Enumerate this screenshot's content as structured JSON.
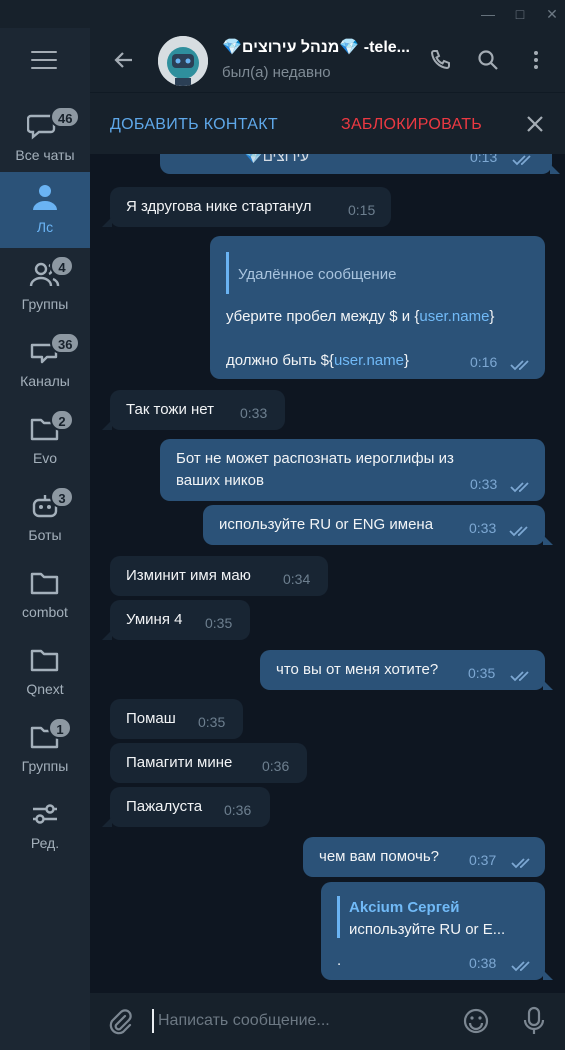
{
  "window": {
    "minimize": "—",
    "maximize": "□",
    "close": "✕"
  },
  "rail": {
    "folders": [
      {
        "label": "Все чаты",
        "badge": "46",
        "icon": "chats-icon"
      },
      {
        "label": "Лс",
        "badge": "",
        "icon": "person-icon"
      },
      {
        "label": "Группы",
        "badge": "4",
        "icon": "group-icon"
      },
      {
        "label": "Каналы",
        "badge": "36",
        "icon": "channel-icon"
      },
      {
        "label": "Evo",
        "badge": "2",
        "icon": "folder-icon"
      },
      {
        "label": "Боты",
        "badge": "3",
        "icon": "bot-icon"
      },
      {
        "label": "combot",
        "badge": "",
        "icon": "folder-icon"
      },
      {
        "label": "Qnext",
        "badge": "",
        "icon": "folder-icon"
      },
      {
        "label": "Группы",
        "badge": "1",
        "icon": "folder-icon"
      },
      {
        "label": "Ред.",
        "badge": "",
        "icon": "edit-sliders-icon"
      }
    ]
  },
  "header": {
    "title": "💎מנהל עירוצים💎 -tele...",
    "status": "был(а) недавно"
  },
  "actions": {
    "add_contact": "ДОБАВИТЬ КОНТАКТ",
    "block": "ЗАБЛОКИРОВАТЬ"
  },
  "messages": [
    {
      "text": "💎עירוצים",
      "time": "0:13"
    },
    {
      "text": "Я здругова нике стартанул",
      "time": "0:15"
    },
    {
      "quote": "Удалённое сообщение",
      "line1a": "уберите пробел между $ и {",
      "line1link": "user.name",
      "line1b": "}",
      "line2a": "должно быть ${",
      "line2link": "user.name",
      "line2b": "}",
      "time": "0:16"
    },
    {
      "text": "Так тожи нет",
      "time": "0:33"
    },
    {
      "line1": "Бот не может распознать иероглифы из",
      "line2": "ваших ников",
      "time": "0:33"
    },
    {
      "text": "используйте RU or ENG имена",
      "time": "0:33"
    },
    {
      "text": "Изминит имя маю",
      "time": "0:34"
    },
    {
      "text": "Уминя 4",
      "time": "0:35"
    },
    {
      "text": "что вы от меня хотите?",
      "time": "0:35"
    },
    {
      "text": "Помаш",
      "time": "0:35"
    },
    {
      "text": "Памагити мине",
      "time": "0:36"
    },
    {
      "text": "Пажалуста",
      "time": "0:36"
    },
    {
      "text": "чем вам помочь?",
      "time": "0:37"
    },
    {
      "reply_author": "Akcium Сергей",
      "reply_text": "используйте RU or E...",
      "text": ".",
      "time": "0:38"
    }
  ],
  "composer": {
    "placeholder": "Написать сообщение..."
  },
  "colors": {
    "accent": "#6ab3f3",
    "danger": "#ec3942",
    "bubble_out": "#2b5278",
    "bubble_in": "#182533",
    "active_folder": "#2b5278"
  }
}
